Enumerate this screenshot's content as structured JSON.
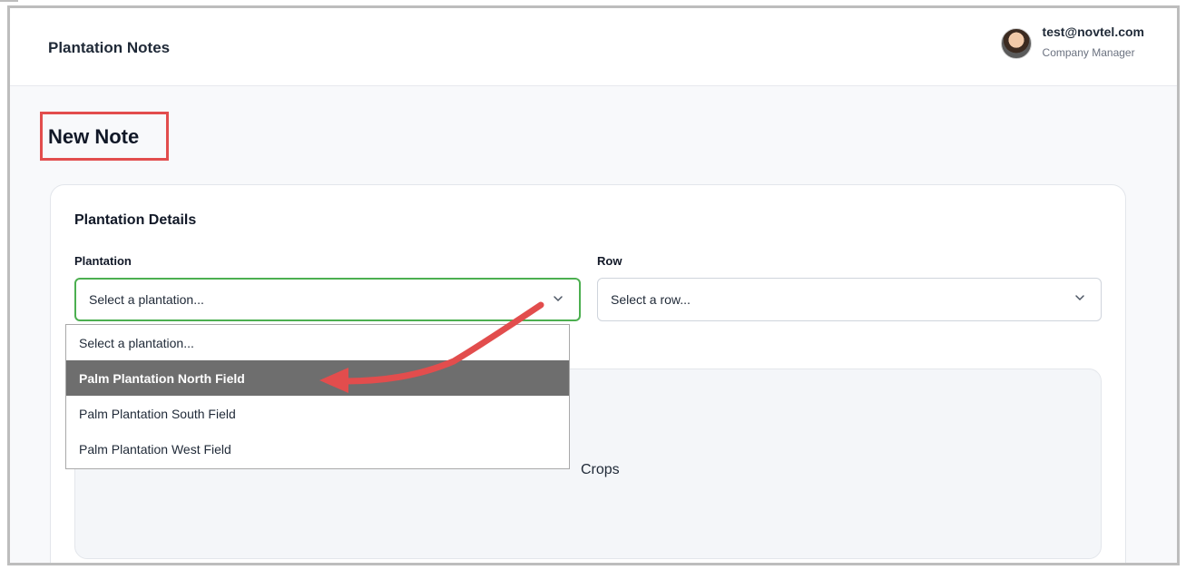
{
  "header": {
    "app_title": "Plantation Notes",
    "user": {
      "email": "test@novtel.com",
      "role": "Company Manager"
    }
  },
  "page": {
    "title": "New Note"
  },
  "plantation_details": {
    "section_title": "Plantation Details",
    "plantation_label": "Plantation",
    "plantation_value": "Select a plantation...",
    "row_label": "Row",
    "row_value": "Select a row...",
    "dropdown_options": [
      "Select a plantation...",
      "Palm Plantation North Field",
      "Palm Plantation South Field",
      "Palm Plantation West Field"
    ],
    "highlighted_option_index": 1,
    "crops_fragment": "Crops"
  },
  "colors": {
    "annotation_red": "#e24d4d",
    "focus_green": "#4caf50",
    "highlight_gray": "#6e6e6e"
  }
}
